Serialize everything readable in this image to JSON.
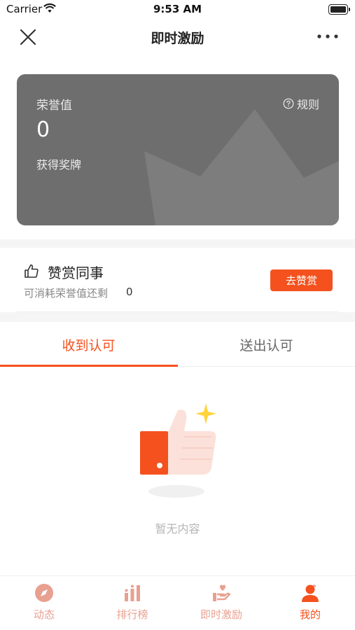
{
  "status_bar": {
    "carrier": "Carrier",
    "time": "9:53 AM"
  },
  "nav": {
    "title": "即时激励",
    "close_icon": "close-icon",
    "more_icon": "more-icon"
  },
  "honor_card": {
    "label": "荣誉值",
    "value": "0",
    "medal_link": "获得奖牌",
    "rules_label": "规则"
  },
  "praise": {
    "title": "赞赏同事",
    "remaining_label": "可消耗荣誉值还剩",
    "remaining_value": "0",
    "button_label": "去赞赏"
  },
  "tabs": [
    {
      "label": "收到认可",
      "active": true
    },
    {
      "label": "送出认可",
      "active": false
    }
  ],
  "empty_state": {
    "text": "暂无内容"
  },
  "bottom_tabs": [
    {
      "label": "动态",
      "icon": "compass-icon",
      "active": false
    },
    {
      "label": "排行榜",
      "icon": "ranking-icon",
      "active": false
    },
    {
      "label": "即时激励",
      "icon": "heart-hand-icon",
      "active": false
    },
    {
      "label": "我的",
      "icon": "person-icon",
      "active": true
    }
  ],
  "colors": {
    "accent": "#f4511e",
    "card": "#6e6e6e",
    "inactive_tab": "#e8a090"
  }
}
